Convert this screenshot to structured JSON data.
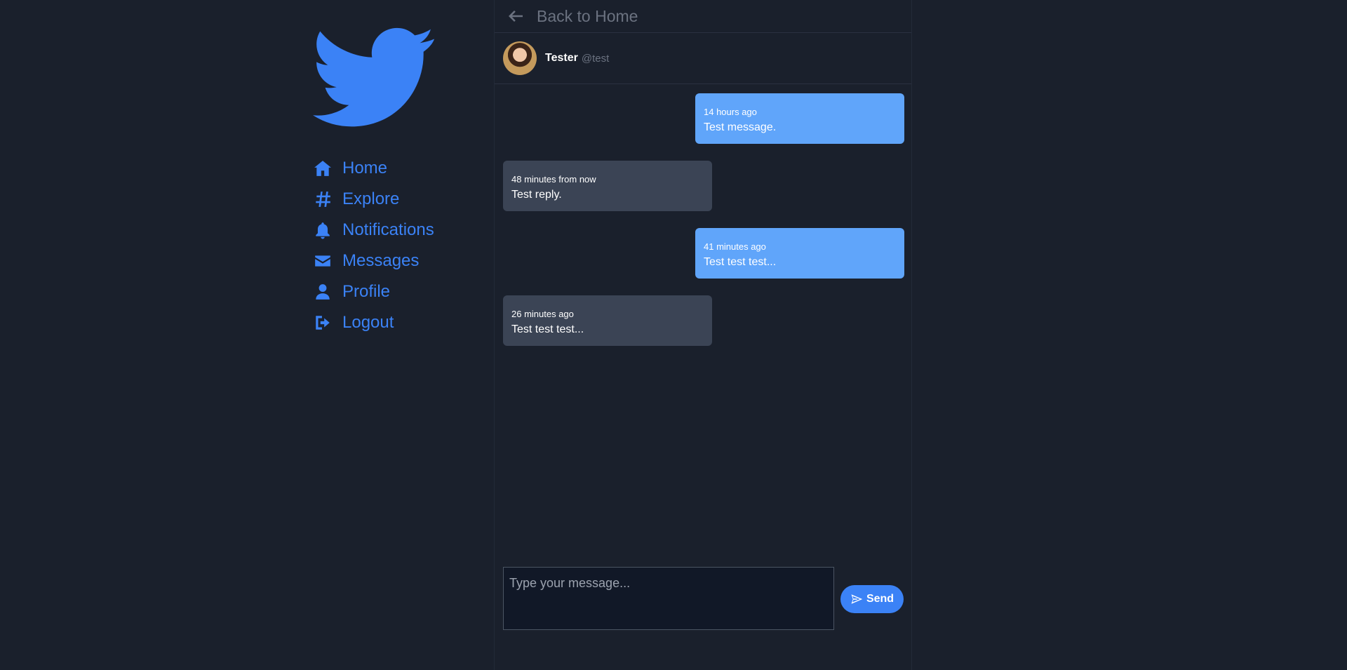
{
  "sidebar": {
    "logo_icon": "twitter-bird-icon",
    "items": [
      {
        "label": "Home",
        "icon": "home-icon"
      },
      {
        "label": "Explore",
        "icon": "hashtag-icon"
      },
      {
        "label": "Notifications",
        "icon": "bell-icon"
      },
      {
        "label": "Messages",
        "icon": "envelope-icon"
      },
      {
        "label": "Profile",
        "icon": "user-icon"
      },
      {
        "label": "Logout",
        "icon": "logout-icon"
      }
    ]
  },
  "header": {
    "back_label": "Back to Home"
  },
  "conversation": {
    "name": "Tester",
    "handle": "@test"
  },
  "messages": [
    {
      "from": "me",
      "time": "14 hours ago",
      "text": "Test message."
    },
    {
      "from": "them",
      "time": "48 minutes from now",
      "text": "Test reply."
    },
    {
      "from": "me",
      "time": "41 minutes ago",
      "text": "Test test test..."
    },
    {
      "from": "them",
      "time": "26 minutes ago",
      "text": "Test test test..."
    }
  ],
  "composer": {
    "placeholder": "Type your message...",
    "send_label": "Send"
  },
  "colors": {
    "background": "#1a202c",
    "accent": "#3b82f6",
    "my_bubble": "#60a5fa",
    "their_bubble": "#3b4455"
  }
}
